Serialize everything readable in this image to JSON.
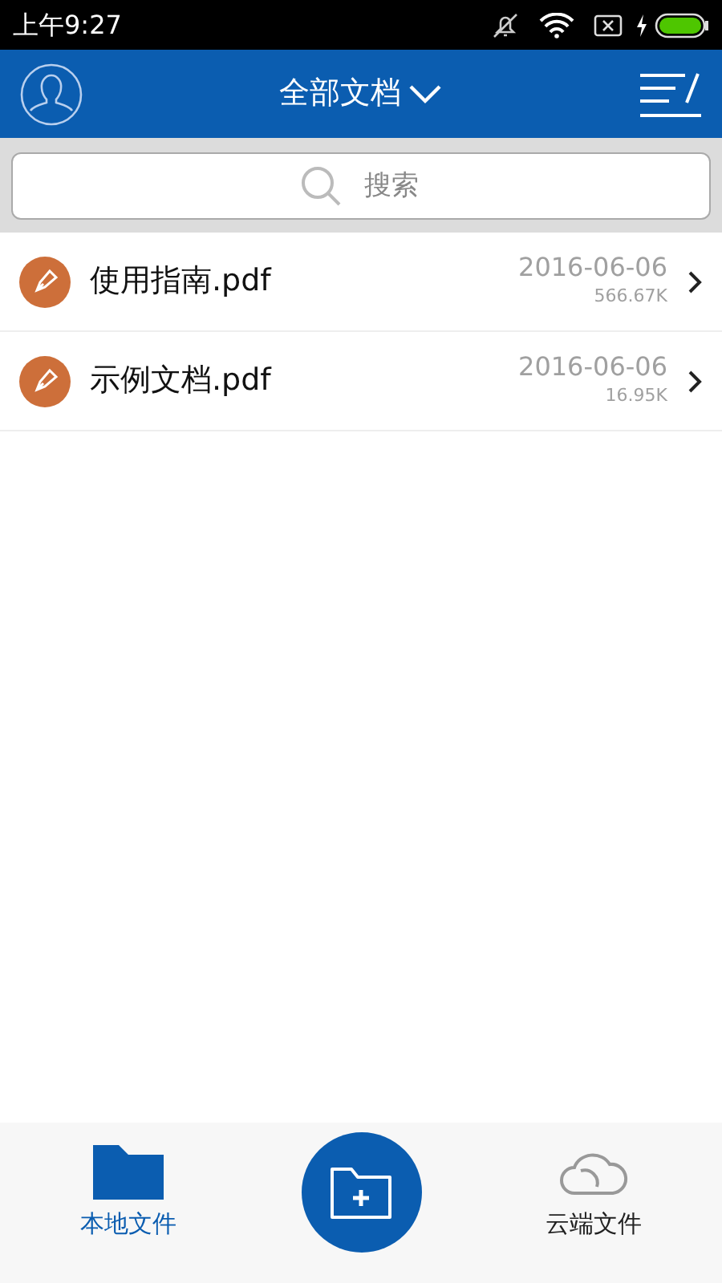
{
  "status_bar": {
    "time": "上午9:27"
  },
  "header": {
    "title": "全部文档"
  },
  "search": {
    "placeholder": "搜索"
  },
  "files": [
    {
      "name": "使用指南.pdf",
      "date": "2016-06-06",
      "size": "566.67K"
    },
    {
      "name": "示例文档.pdf",
      "date": "2016-06-06",
      "size": "16.95K"
    }
  ],
  "bottom_nav": [
    {
      "kind": "local",
      "label": "本地文件",
      "selected": true
    },
    {
      "kind": "add"
    },
    {
      "kind": "cloud",
      "label": "云端文件",
      "selected": false
    }
  ]
}
